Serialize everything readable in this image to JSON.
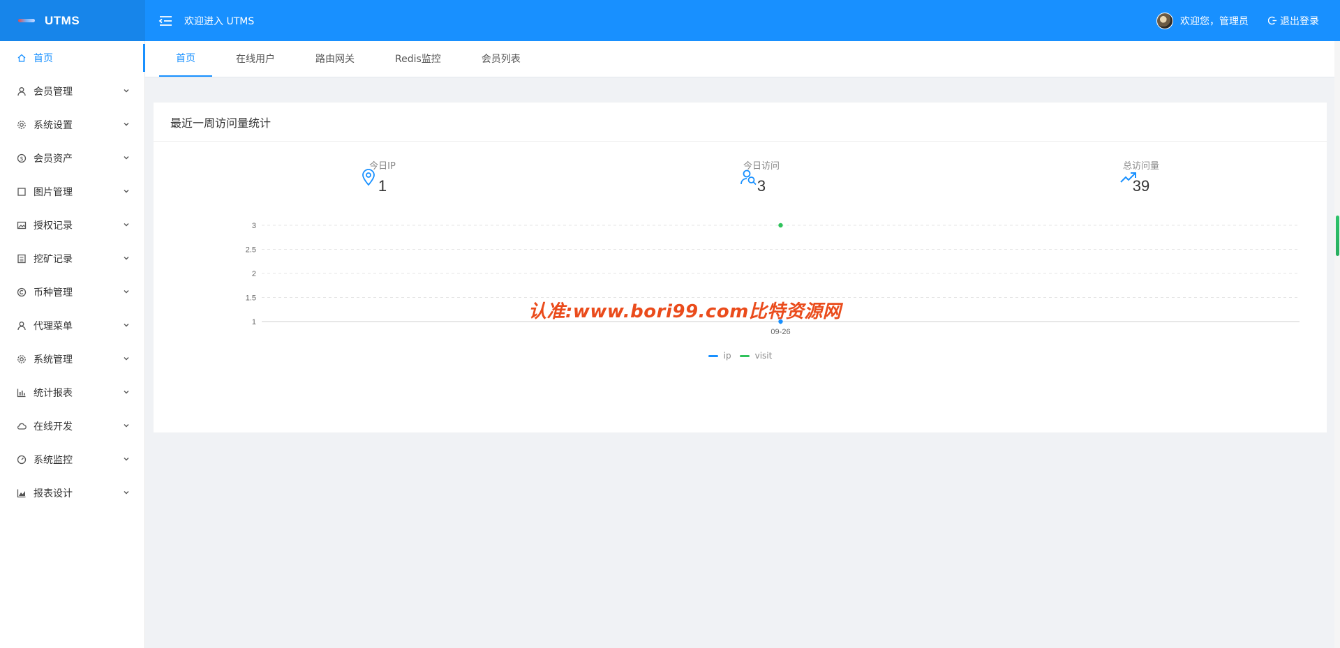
{
  "header": {
    "brand": "UTMS",
    "welcome": "欢迎进入 UTMS",
    "user_greeting": "欢迎您，管理员",
    "logout": "退出登录",
    "accent_color": "#1890ff"
  },
  "sidebar": {
    "items": [
      {
        "label": "首页",
        "icon": "home-icon"
      },
      {
        "label": "会员管理",
        "icon": "user-icon"
      },
      {
        "label": "系统设置",
        "icon": "gear-icon"
      },
      {
        "label": "会员资产",
        "icon": "dollar-circle-icon"
      },
      {
        "label": "图片管理",
        "icon": "square-icon"
      },
      {
        "label": "授权记录",
        "icon": "picture-icon"
      },
      {
        "label": "挖矿记录",
        "icon": "list-icon"
      },
      {
        "label": "币种管理",
        "icon": "copyright-icon"
      },
      {
        "label": "代理菜单",
        "icon": "user-icon"
      },
      {
        "label": "系统管理",
        "icon": "gear-icon"
      },
      {
        "label": "统计报表",
        "icon": "bar-chart-icon"
      },
      {
        "label": "在线开发",
        "icon": "cloud-icon"
      },
      {
        "label": "系统监控",
        "icon": "dashboard-icon"
      },
      {
        "label": "报表设计",
        "icon": "area-chart-icon"
      }
    ]
  },
  "tabs": [
    {
      "label": "首页"
    },
    {
      "label": "在线用户"
    },
    {
      "label": "路由网关"
    },
    {
      "label": "Redis监控"
    },
    {
      "label": "会员列表"
    }
  ],
  "card": {
    "title": "最近一周访问量统计",
    "stats": [
      {
        "label": "今日IP",
        "value": "1",
        "icon": "location-pin-icon"
      },
      {
        "label": "今日访问",
        "value": "3",
        "icon": "users-search-icon"
      },
      {
        "label": "总访问量",
        "value": "39",
        "icon": "trend-up-icon"
      }
    ]
  },
  "chart_data": {
    "type": "scatter",
    "x": [
      "09-26"
    ],
    "series": [
      {
        "name": "ip",
        "values": [
          1
        ],
        "color": "#1890ff"
      },
      {
        "name": "visit",
        "values": [
          3
        ],
        "color": "#2fc25b"
      }
    ],
    "ylim": [
      1,
      3
    ],
    "yticks": [
      "3",
      "2.5",
      "2",
      "1.5",
      "1"
    ],
    "legend": "bottom-center",
    "grid": true
  },
  "watermark": "认准:www.bori99.com比特资源网"
}
